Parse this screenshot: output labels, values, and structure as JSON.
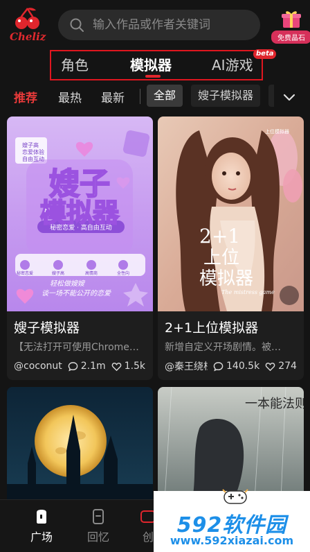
{
  "app": {
    "logo_text": "Cheliz"
  },
  "search": {
    "placeholder": "输入作品或作者关键词"
  },
  "gift": {
    "label": "免费晶石"
  },
  "main_tabs": [
    {
      "label": "角色",
      "active": false
    },
    {
      "label": "模拟器",
      "active": true
    },
    {
      "label": "AI游戏",
      "active": false,
      "badge": "beta"
    }
  ],
  "filters": {
    "sort": [
      {
        "label": "推荐",
        "active": true
      },
      {
        "label": "最热",
        "active": false
      },
      {
        "label": "最新",
        "active": false
      }
    ],
    "categories": [
      {
        "label": "全部",
        "active": true
      },
      {
        "label": "嫂子模拟器",
        "active": false
      }
    ]
  },
  "cards": [
    {
      "title": "嫂子模拟器",
      "description": "【无法打开可使用Chrome…",
      "author": "@coconut",
      "comments": "2.1m",
      "likes": "1.5k",
      "cover": {
        "big_text_1": "嫂子",
        "big_text_2": "模拟器",
        "banner": "秘密恋爱 · 高自由互动",
        "stamp_1": "嫂子高",
        "stamp_2": "恋爱体验",
        "stamp_3": "自由互动",
        "icons": [
          "秘密恋爱",
          "嫂子高",
          "高情商",
          "全性向"
        ],
        "script_1": "轻松做嫂嫂",
        "script_2": "谈一场不能公开的恋爱"
      }
    },
    {
      "title": "2+1上位模拟器",
      "description": "新增自定义开场剧情。被…",
      "author": "@秦王绕柱",
      "comments": "140.5k",
      "likes": "274",
      "cover": {
        "big_text_1": "2+1",
        "big_text_2": "上位",
        "big_text_3": "模拟器",
        "corner_text": "上位模拟器",
        "script": "The mistress game"
      }
    },
    {
      "cover": {}
    },
    {
      "cover": {
        "title": "一本能法则"
      }
    }
  ],
  "bottom_nav": [
    {
      "label": "广场",
      "active": true
    },
    {
      "label": "回忆",
      "active": false
    },
    {
      "label": "创",
      "active": false
    }
  ],
  "watermark": {
    "top": "592软件园",
    "bottom": "www.592xiazai.com"
  },
  "colors": {
    "accent": "#e0262d",
    "background": "#141414",
    "watermark": "#1d8fe8"
  }
}
